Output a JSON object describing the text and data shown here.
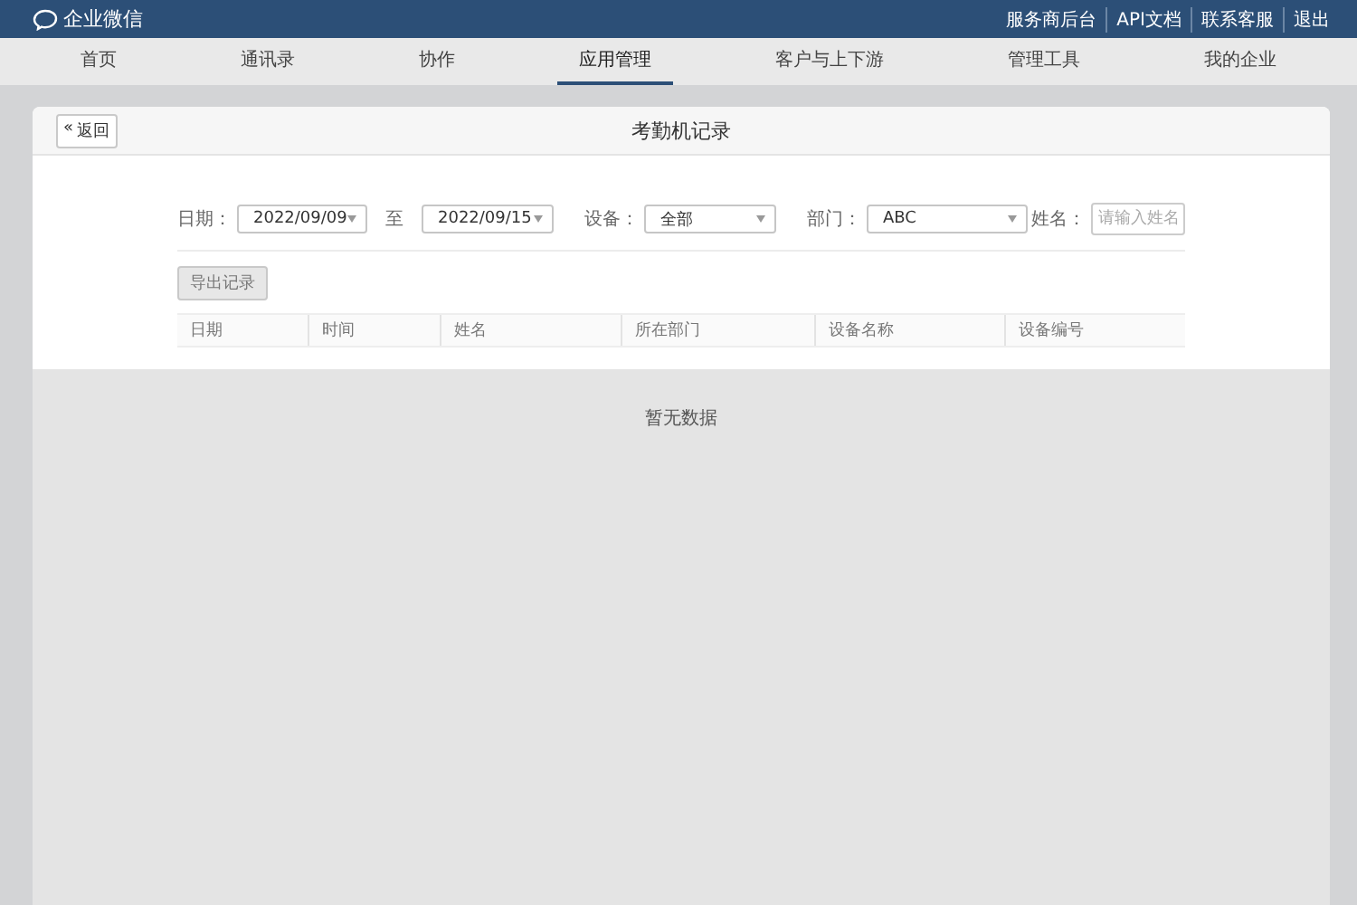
{
  "header": {
    "logo": "企业微信",
    "links": [
      "服务商后台",
      "API文档",
      "联系客服",
      "退出"
    ]
  },
  "tabs": [
    {
      "label": "首页",
      "selected": false
    },
    {
      "label": "通讯录",
      "selected": false
    },
    {
      "label": "协作",
      "selected": false
    },
    {
      "label": "应用管理",
      "selected": true
    },
    {
      "label": "客户与上下游",
      "selected": false
    },
    {
      "label": "管理工具",
      "selected": false
    },
    {
      "label": "我的企业",
      "selected": false
    }
  ],
  "back_button": "返回",
  "back_icon": "«",
  "title": "考勤机记录",
  "filters": {
    "date_label": "日期：",
    "date_from": "2022/09/09",
    "to_label": "至",
    "date_to": "2022/09/15",
    "device_label": "设备：",
    "device": "全部",
    "dept_label": "部门：",
    "dept": "ABC",
    "name_label": "姓名：",
    "name_placeholder": "请输入姓名"
  },
  "export_button": "导出记录",
  "table": {
    "columns": [
      "日期",
      "时间",
      "姓名",
      "所在部门",
      "设备名称",
      "设备编号"
    ]
  },
  "empty_text": "暂无数据"
}
